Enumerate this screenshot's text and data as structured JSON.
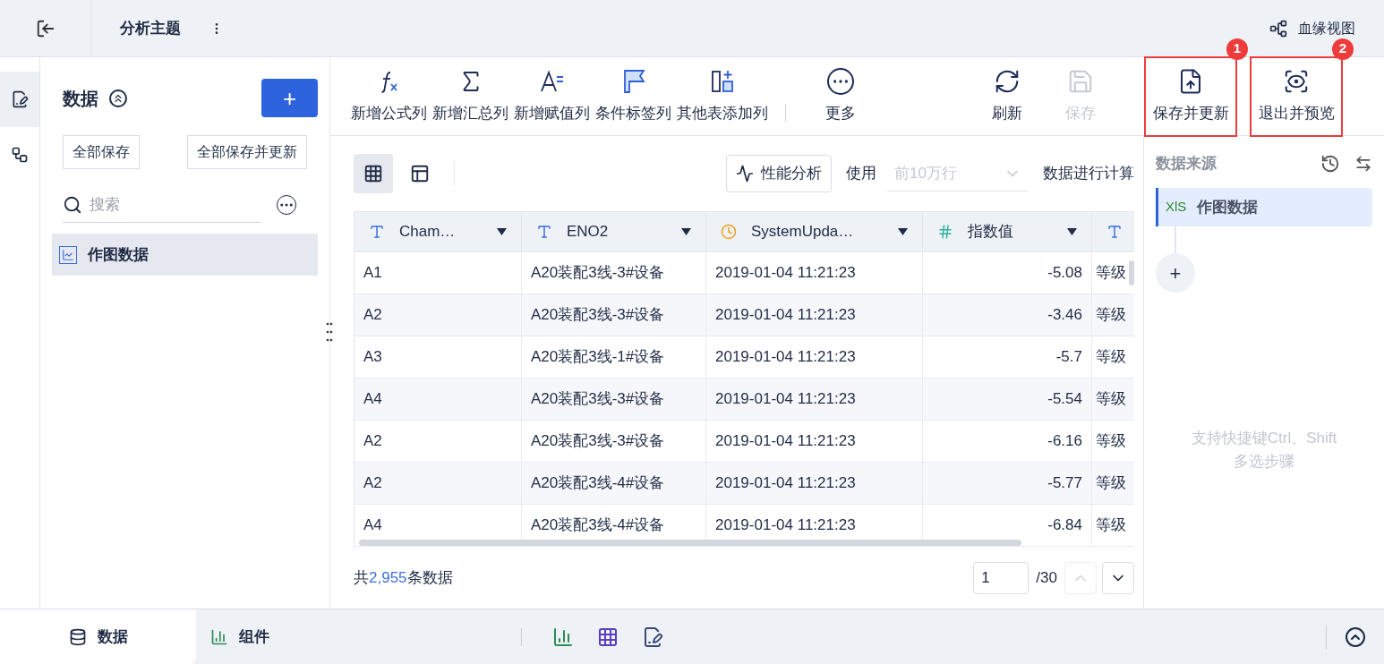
{
  "top_bar": {
    "title": "分析主题",
    "lineage_label": "血缘视图"
  },
  "rail": [
    {
      "kind": "edit",
      "selected": true
    },
    {
      "kind": "flow",
      "selected": false
    }
  ],
  "left_panel": {
    "title": "数据",
    "add_button": "+",
    "buttons": [
      "全部保存",
      "全部保存并更新"
    ],
    "search": {
      "placeholder": "搜索"
    },
    "items": [
      {
        "label": "作图数据",
        "selected": true
      }
    ]
  },
  "toolbar": [
    {
      "kind": "formula",
      "label": "新增公式列",
      "disabled": false
    },
    {
      "kind": "sum",
      "label": "新增汇总列",
      "disabled": false
    },
    {
      "kind": "assign",
      "label": "新增赋值列",
      "disabled": false
    },
    {
      "kind": "tag",
      "label": "条件标签列",
      "disabled": false
    },
    {
      "kind": "addcol",
      "label": "其他表添加列",
      "disabled": false
    },
    {
      "kind": "more",
      "label": "更多",
      "disabled": false
    },
    {
      "kind": "refresh",
      "label": "刷新",
      "disabled": false
    },
    {
      "kind": "save",
      "label": "保存",
      "disabled": true
    },
    {
      "kind": "saveupdate",
      "label": "保存并更新",
      "disabled": false,
      "marker": "1"
    },
    {
      "kind": "preview",
      "label": "退出并预览",
      "disabled": false,
      "marker": "2"
    }
  ],
  "view_toggles": [
    {
      "kind": "grid",
      "selected": true
    },
    {
      "kind": "layout",
      "selected": false
    }
  ],
  "perf_button": "性能分析",
  "use_label": "使用",
  "row_limit": {
    "value": "前10万行",
    "disabled": true
  },
  "compute_label": "数据进行计算",
  "table": {
    "columns": [
      {
        "label": "Cham…",
        "kind": "text"
      },
      {
        "label": "ENO2",
        "kind": "text"
      },
      {
        "label": "SystemUpda…",
        "kind": "date"
      },
      {
        "label": "指数值",
        "kind": "number"
      },
      {
        "kind": "text"
      }
    ],
    "rows": [
      [
        "A1",
        "A20装配3线-3#设备",
        "2019-01-04 11:21:23",
        "-5.08",
        "等级"
      ],
      [
        "A2",
        "A20装配3线-3#设备",
        "2019-01-04 11:21:23",
        "-3.46",
        "等级"
      ],
      [
        "A3",
        "A20装配3线-1#设备",
        "2019-01-04 11:21:23",
        "-5.7",
        "等级"
      ],
      [
        "A4",
        "A20装配3线-3#设备",
        "2019-01-04 11:21:23",
        "-5.54",
        "等级"
      ],
      [
        "A2",
        "A20装配3线-3#设备",
        "2019-01-04 11:21:23",
        "-6.16",
        "等级"
      ],
      [
        "A2",
        "A20装配3线-4#设备",
        "2019-01-04 11:21:23",
        "-5.77",
        "等级"
      ],
      [
        "A4",
        "A20装配3线-4#设备",
        "2019-01-04 11:21:23",
        "-6.84",
        "等级"
      ]
    ]
  },
  "footer": {
    "prefix": "共",
    "count": "2,955",
    "suffix": "条数据",
    "page": "1",
    "total_pages": "/30",
    "prev_disabled": true
  },
  "source_panel": {
    "title": "数据来源",
    "steps": [
      {
        "icon_text": "XlS",
        "label": "作图数据",
        "selected": true
      }
    ],
    "add_button": "+",
    "hint_lines": [
      "支持快捷键Ctrl、Shift",
      "多选步骤"
    ]
  },
  "bottom_tabs": [
    {
      "label": "数据",
      "kind": "data",
      "selected": true
    },
    {
      "label": "组件",
      "kind": "widget",
      "selected": false
    }
  ]
}
